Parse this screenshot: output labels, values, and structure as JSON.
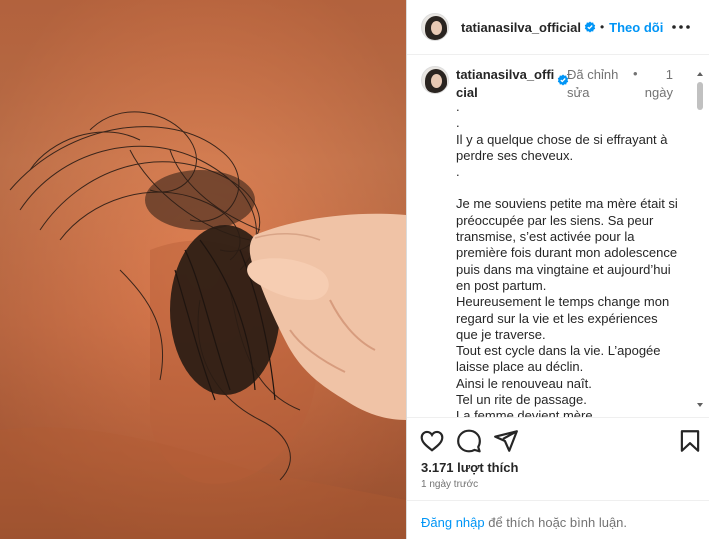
{
  "post": {
    "image_alt": "hand holding strands of dark hair against an orange wall"
  },
  "header": {
    "username": "tatianasilva_official",
    "dot": "•",
    "follow_label": "Theo dõi"
  },
  "caption": {
    "username_line1": "tatianasilva_offi",
    "username_line2": "cial",
    "edited_line1": "Đã chỉnh",
    "edited_line2": "sửa",
    "sep": "•",
    "time_line1": "1",
    "time_line2": "ngày",
    "lines": [
      ".",
      ".",
      "Il y a quelque chose de si effrayant à perdre ses cheveux.",
      ".",
      "",
      "Je me souviens petite ma mère était si préoccupée par les siens. Sa peur transmise, s’est activée pour la première fois durant mon adolescence puis dans ma vingtaine et aujourd’hui en post partum.",
      "Heureusement le temps change mon regard sur la vie et les expériences que je traverse.",
      "Tout est cycle dans la vie. L’apogée laisse place au déclin.",
      "Ainsi le renouveau naît.",
      "Tel un rite de passage.",
      "La femme devient mère."
    ]
  },
  "engagement": {
    "likes": "3.171 lượt thích",
    "time_ago": "1 ngày trước"
  },
  "footer": {
    "login_link": "Đăng nhập",
    "login_rest": " để thích hoặc bình luận."
  },
  "colors": {
    "accent": "#0095f6",
    "muted": "#737373",
    "wall": "#d9774a"
  }
}
